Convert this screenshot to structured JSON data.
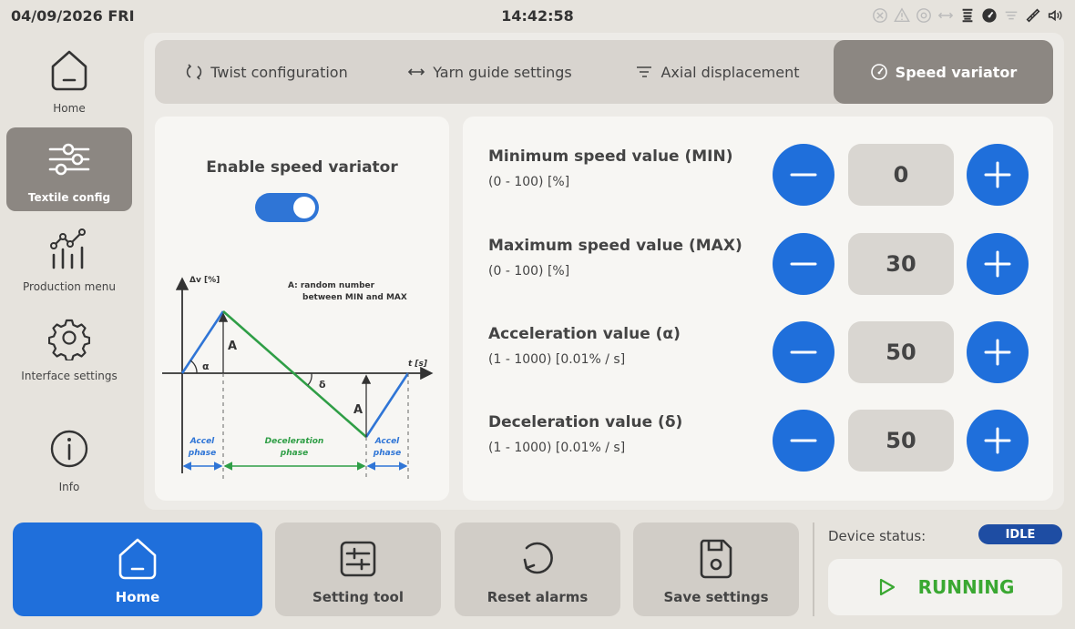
{
  "header": {
    "date": "04/09/2026 FRI",
    "time": "14:42:58",
    "status_icons": [
      "cancel-circle-icon",
      "warning-icon",
      "speed-variator-icon",
      "yarn-guide-icon",
      "spool-icon",
      "speed-gauge-icon",
      "axial-displacement-icon",
      "measure-icon",
      "sound-icon"
    ]
  },
  "sidebar": {
    "items": [
      {
        "label": "Home",
        "icon": "home-icon"
      },
      {
        "label": "Textile config",
        "icon": "sliders-icon",
        "active": true
      },
      {
        "label": "Production menu",
        "icon": "chart-icon"
      },
      {
        "label": "Interface settings",
        "icon": "gear-icon"
      },
      {
        "label": "Info",
        "icon": "info-icon"
      }
    ]
  },
  "tabs": [
    {
      "label": "Twist configuration",
      "icon": "twist-icon"
    },
    {
      "label": "Yarn guide settings",
      "icon": "arrows-horizontal-icon"
    },
    {
      "label": "Axial displacement",
      "icon": "axial-icon"
    },
    {
      "label": "Speed variator",
      "icon": "speed-gauge-icon",
      "active": true
    }
  ],
  "enable": {
    "title": "Enable speed variator",
    "on": true
  },
  "diagram": {
    "y_label": "Δv [%]",
    "x_label": "t [s]",
    "note_line1": "A: random number",
    "note_line2": "between MIN and MAX",
    "alpha": "α",
    "delta": "δ",
    "a_label": "A",
    "accel_line1": "Accel",
    "accel_line2": "phase",
    "decel_line1": "Deceleration",
    "decel_line2": "phase",
    "colors": {
      "accel": "#2f75d6",
      "decel": "#2f9e46",
      "axis": "#333333"
    }
  },
  "params": [
    {
      "name": "Minimum speed value (MIN)",
      "range": "(0 - 100) [%]",
      "value": "0"
    },
    {
      "name": "Maximum speed value (MAX)",
      "range": "(0 - 100) [%]",
      "value": "30"
    },
    {
      "name": "Acceleration value (α)",
      "range": "(1 - 1000) [0.01% / s]",
      "value": "50"
    },
    {
      "name": "Deceleration value (δ)",
      "range": "(1 - 1000) [0.01% / s]",
      "value": "50"
    }
  ],
  "bottom": {
    "home": "Home",
    "setting_tool": "Setting tool",
    "reset_alarms": "Reset alarms",
    "save_settings": "Save settings",
    "device_status_label": "Device status:",
    "device_status": "IDLE",
    "running": "RUNNING"
  },
  "colors": {
    "accent": "#1f6fdb",
    "active_tab": "#8c8782",
    "running_green": "#3aa832",
    "idle_badge": "#1e4da3"
  }
}
